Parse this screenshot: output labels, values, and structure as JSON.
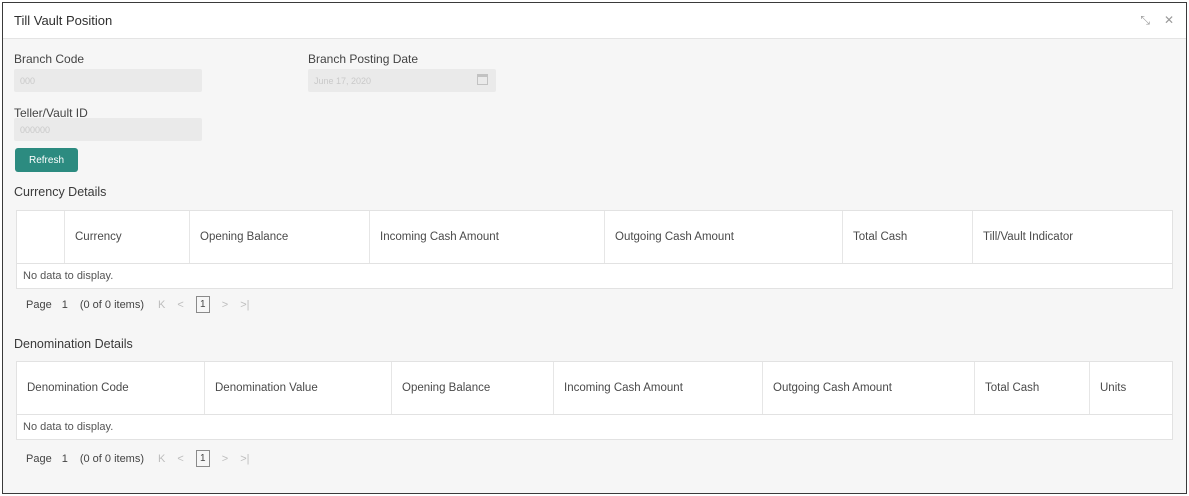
{
  "window": {
    "title": "Till Vault Position"
  },
  "fields": {
    "branch_code": {
      "label": "Branch Code",
      "value": "000"
    },
    "posting_date": {
      "label": "Branch Posting Date",
      "value": "June 17, 2020"
    },
    "teller_vault": {
      "label": "Teller/Vault ID",
      "value": "000000"
    }
  },
  "actions": {
    "refresh": "Refresh"
  },
  "currency": {
    "title": "Currency Details",
    "columns": [
      "",
      "Currency",
      "Opening Balance",
      "Incoming Cash Amount",
      "Outgoing Cash Amount",
      "Total Cash",
      "Till/Vault Indicator"
    ],
    "empty": "No data to display.",
    "pager": {
      "label": "Page",
      "page": "1",
      "count": "(0 of 0 items)",
      "current": "1"
    }
  },
  "denomination": {
    "title": "Denomination Details",
    "columns": [
      "Denomination Code",
      "Denomination Value",
      "Opening Balance",
      "Incoming Cash Amount",
      "Outgoing Cash Amount",
      "Total Cash",
      "Units"
    ],
    "empty": "No data to display.",
    "pager": {
      "label": "Page",
      "page": "1",
      "count": "(0 of 0 items)",
      "current": "1"
    }
  },
  "icons": {
    "minimize": "compress-icon",
    "close": "close-icon",
    "calendar": "calendar-icon"
  }
}
